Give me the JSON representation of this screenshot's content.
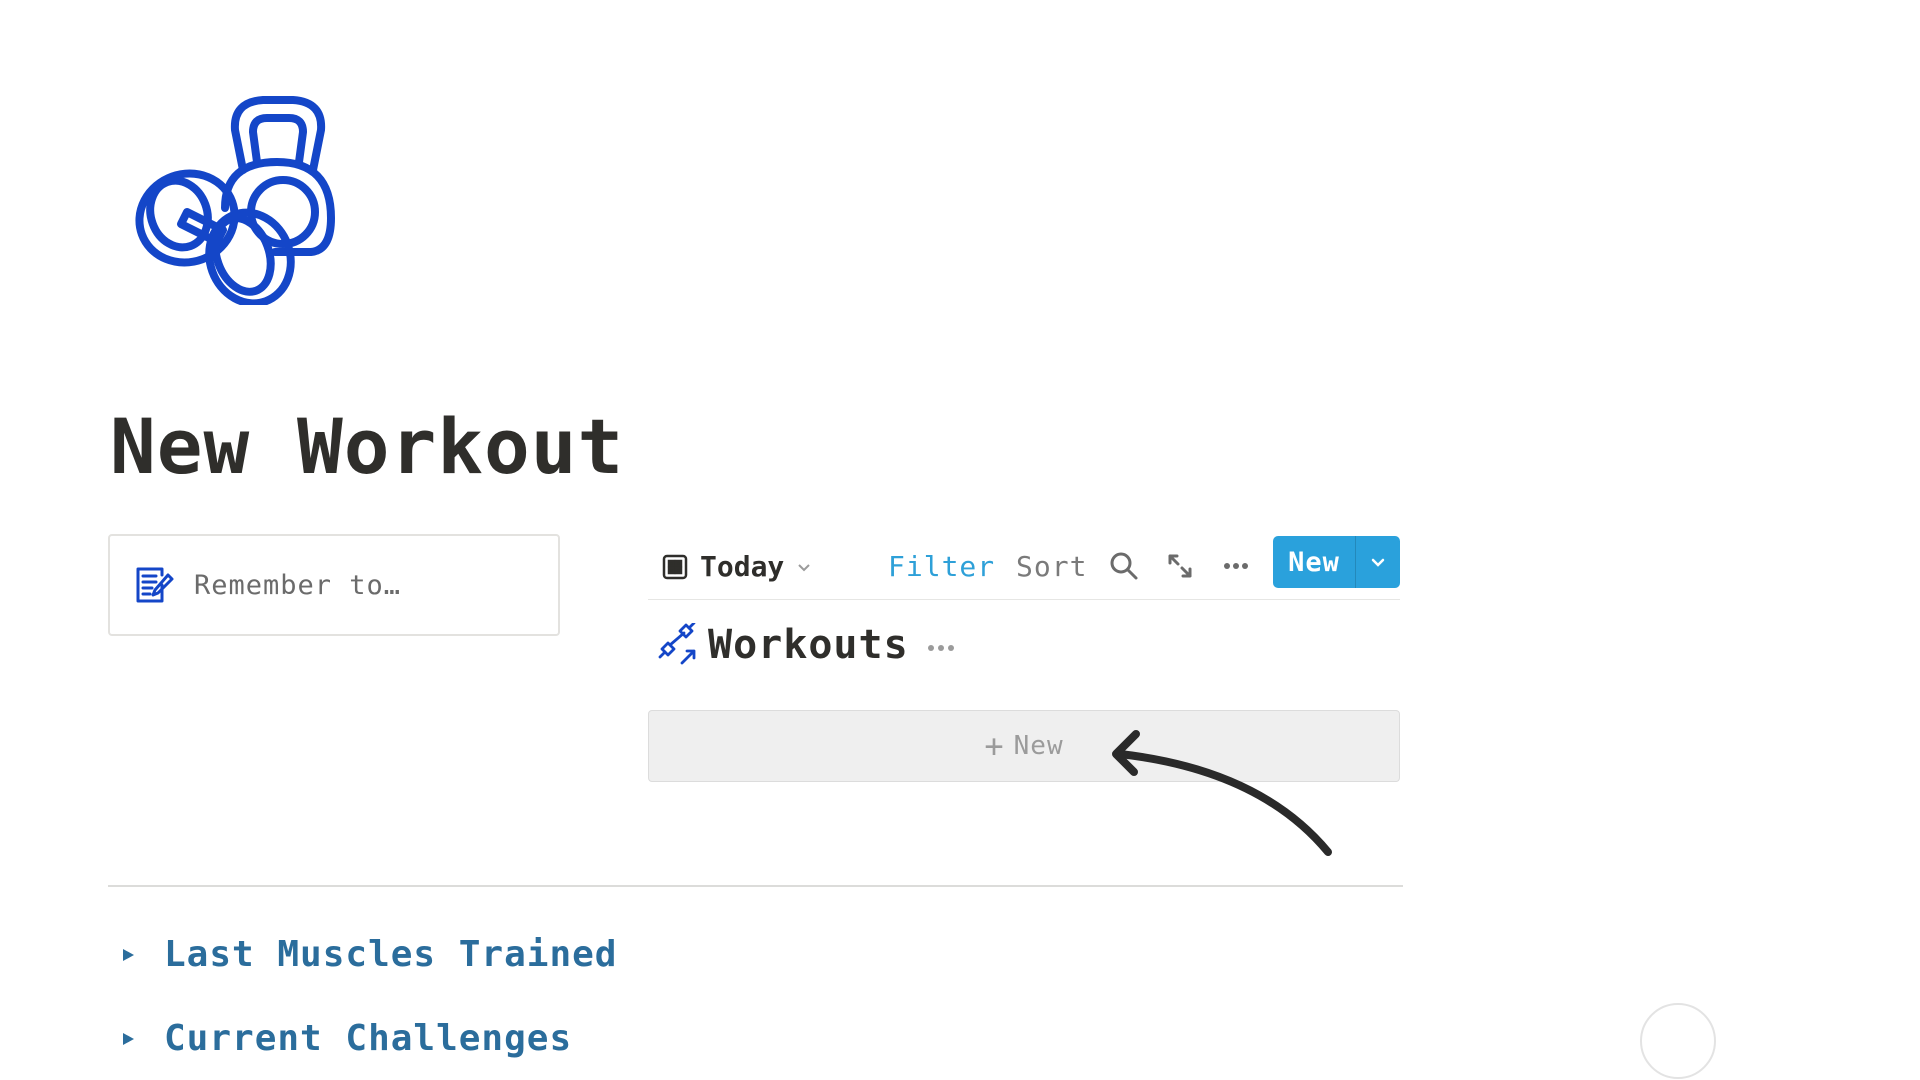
{
  "page": {
    "icon": "kettlebell-dumbbell-icon",
    "title": "New Workout"
  },
  "callout": {
    "icon": "notepad-edit-icon",
    "text": "Remember to…"
  },
  "database": {
    "view": {
      "icon": "table-view-icon",
      "label": "Today"
    },
    "toolbar": {
      "filter_label": "Filter",
      "sort_label": "Sort",
      "search_icon": "search-icon",
      "expand_icon": "expand-arrows-icon",
      "more_icon": "more-dots-icon",
      "new_label": "New",
      "new_dropdown_icon": "chevron-down-icon"
    },
    "title": "Workouts",
    "title_icon": "dumbbell-arrow-icon",
    "add_row_label": "New"
  },
  "toggles": [
    {
      "label": "Last Muscles Trained"
    },
    {
      "label": "Current Challenges"
    }
  ],
  "colors": {
    "accent_blue": "#2aa1dc",
    "link_blue": "#2ea0d8",
    "toggle_blue": "#2b6d9c",
    "icon_blue": "#1446c8"
  }
}
